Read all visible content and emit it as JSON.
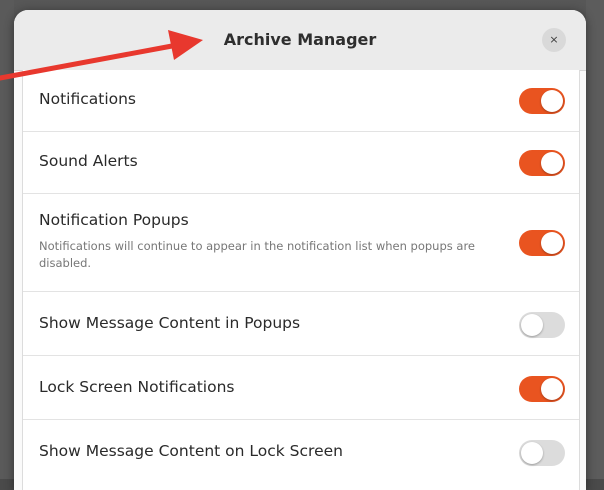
{
  "window": {
    "title": "Archive Manager",
    "close_icon": "close-icon",
    "close_glyph": "×"
  },
  "settings": [
    {
      "label": "Notifications",
      "subtitle": "",
      "enabled": true
    },
    {
      "label": "Sound Alerts",
      "subtitle": "",
      "enabled": true
    },
    {
      "label": "Notification Popups",
      "subtitle": "Notifications will continue to appear in the notification list when popups are disabled.",
      "enabled": true
    },
    {
      "label": "Show Message Content in Popups",
      "subtitle": "",
      "enabled": false
    },
    {
      "label": "Lock Screen Notifications",
      "subtitle": "",
      "enabled": true
    },
    {
      "label": "Show Message Content on Lock Screen",
      "subtitle": "",
      "enabled": false
    }
  ],
  "colors": {
    "accent": "#e95420",
    "toggle_off": "#dcdcdc",
    "annotation_arrow": "#e8382e"
  }
}
